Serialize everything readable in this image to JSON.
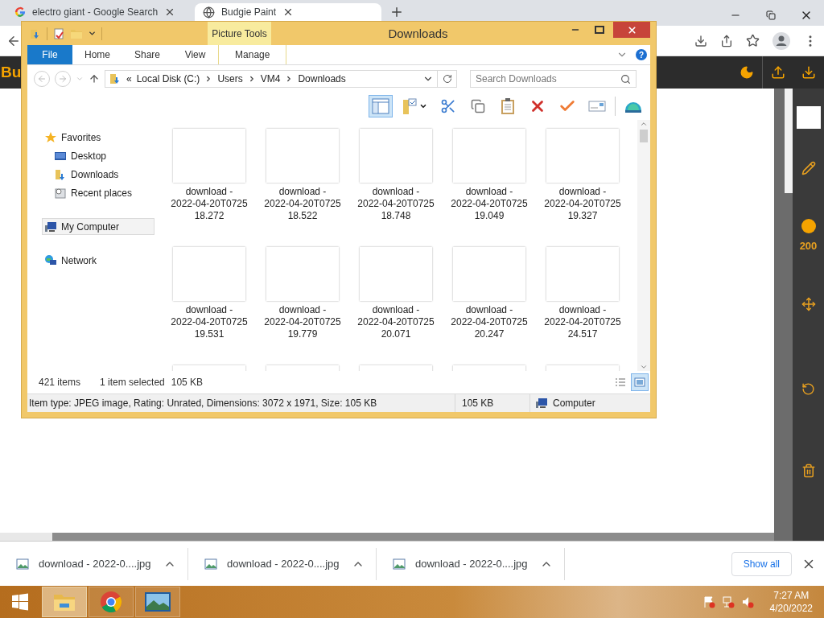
{
  "browser": {
    "tabs": [
      {
        "title": "electro giant - Google Search",
        "kind": "search",
        "selected": false
      },
      {
        "title": "Budgie Paint",
        "kind": "site",
        "selected": true
      }
    ]
  },
  "app": {
    "title": "Bu",
    "brush_size": "200"
  },
  "explorer": {
    "title": "Downloads",
    "context_label": "Picture Tools",
    "ribbon_tabs": [
      {
        "label": "File",
        "kind": "file"
      },
      {
        "label": "Home",
        "kind": "tab"
      },
      {
        "label": "Share",
        "kind": "tab"
      },
      {
        "label": "View",
        "kind": "tab"
      },
      {
        "label": "Manage",
        "kind": "context"
      }
    ],
    "address": {
      "overflow": "«",
      "crumbs": [
        "Local Disk (C:)",
        "Users",
        "VM4",
        "Downloads"
      ]
    },
    "search": {
      "placeholder": "Search Downloads"
    },
    "help": "?",
    "toolbar": [
      {
        "kind": "pane",
        "selected": true
      },
      {
        "kind": "folder",
        "selected": false
      },
      {
        "kind": "cut",
        "selected": false
      },
      {
        "kind": "copy",
        "selected": false
      },
      {
        "kind": "paste",
        "selected": false
      },
      {
        "kind": "delete",
        "selected": false
      },
      {
        "kind": "check",
        "selected": false
      },
      {
        "kind": "rename",
        "selected": false
      },
      {
        "kind": "globe",
        "selected": false
      }
    ],
    "nav": [
      {
        "label": "Favorites",
        "kind": "favorites",
        "selected": false,
        "children": [
          {
            "label": "Desktop",
            "kind": "desktop",
            "selected": false
          },
          {
            "label": "Downloads",
            "kind": "downloads",
            "selected": false
          },
          {
            "label": "Recent places",
            "kind": "recent",
            "selected": false
          }
        ]
      },
      {
        "label": "My Computer",
        "kind": "computer",
        "selected": true
      },
      {
        "label": "Network",
        "kind": "network",
        "selected": false
      }
    ],
    "files": [
      {
        "kind": "file",
        "name": "download -\n2022-04-20T0725\n18.272"
      },
      {
        "kind": "file",
        "name": "download -\n2022-04-20T0725\n18.522"
      },
      {
        "kind": "file",
        "name": "download -\n2022-04-20T0725\n18.748"
      },
      {
        "kind": "file",
        "name": "download -\n2022-04-20T0725\n19.049"
      },
      {
        "kind": "file",
        "name": "download -\n2022-04-20T0725\n19.327"
      },
      {
        "kind": "file",
        "name": "download -\n2022-04-20T0725\n19.531"
      },
      {
        "kind": "file",
        "name": "download -\n2022-04-20T0725\n19.779"
      },
      {
        "kind": "file",
        "name": "download -\n2022-04-20T0725\n20.071"
      },
      {
        "kind": "file",
        "name": "download -\n2022-04-20T0725\n20.247"
      },
      {
        "kind": "file",
        "name": "download -\n2022-04-20T0725\n24.517"
      },
      {
        "kind": "cut_off"
      },
      {
        "kind": "cut_off"
      },
      {
        "kind": "cut_off"
      },
      {
        "kind": "cut_off"
      },
      {
        "kind": "cut_off"
      }
    ],
    "status": {
      "count": "421 items",
      "selection": "1 item selected",
      "size": "105 KB"
    },
    "views": [
      {
        "kind": "details",
        "selected": false
      },
      {
        "kind": "large_icons",
        "selected": true
      }
    ],
    "details": {
      "info": "Item type: JPEG image, Rating: Unrated, Dimensions: 3072 x 1971, Size: 105 KB",
      "size": "105 KB",
      "zone": "Computer"
    }
  },
  "downloads": {
    "items": [
      {
        "name": "download - 2022-0....jpg"
      },
      {
        "name": "download - 2022-0....jpg"
      },
      {
        "name": "download - 2022-0....jpg"
      }
    ],
    "show_all": "Show all"
  },
  "taskbar": {
    "apps": [
      {
        "kind": "explorer",
        "selected": true
      },
      {
        "kind": "browser",
        "selected": false
      },
      {
        "kind": "photos",
        "selected": false
      }
    ],
    "time": "7:27 AM",
    "date": "4/20/2022"
  }
}
